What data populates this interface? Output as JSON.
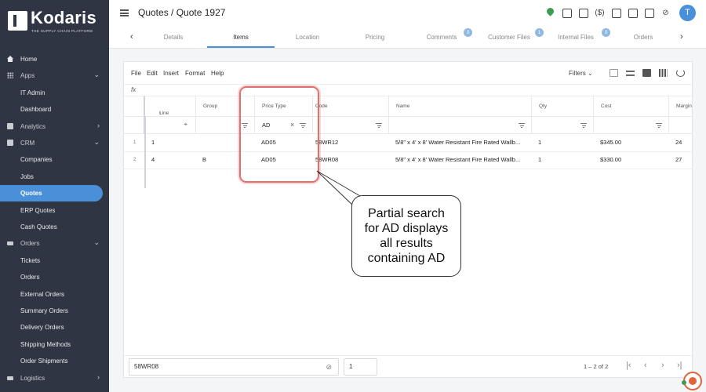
{
  "brand": {
    "name": "Kodaris",
    "tagline": "THE SUPPLY CHAIN PLATFORM"
  },
  "sidebar": {
    "items": [
      {
        "label": "Home",
        "icon": "home-icon",
        "type": "top"
      },
      {
        "label": "Apps",
        "icon": "apps-grid-icon",
        "type": "section",
        "caret": "⌄"
      },
      {
        "label": "IT Admin",
        "type": "child"
      },
      {
        "label": "Dashboard",
        "type": "child"
      },
      {
        "label": "Analytics",
        "icon": "analytics-icon",
        "type": "section",
        "caret": "›"
      },
      {
        "label": "CRM",
        "icon": "crm-icon",
        "type": "section",
        "caret": "⌄"
      },
      {
        "label": "Companies",
        "type": "child"
      },
      {
        "label": "Jobs",
        "type": "child"
      },
      {
        "label": "Quotes",
        "type": "child",
        "active": true
      },
      {
        "label": "ERP Quotes",
        "type": "child"
      },
      {
        "label": "Cash Quotes",
        "type": "child"
      },
      {
        "label": "Orders",
        "icon": "truck-icon",
        "type": "section",
        "caret": "⌄"
      },
      {
        "label": "Tickets",
        "type": "child"
      },
      {
        "label": "Orders",
        "type": "child"
      },
      {
        "label": "External Orders",
        "type": "child"
      },
      {
        "label": "Summary Orders",
        "type": "child"
      },
      {
        "label": "Delivery Orders",
        "type": "child"
      },
      {
        "label": "Shipping Methods",
        "type": "child"
      },
      {
        "label": "Order Shipments",
        "type": "child"
      },
      {
        "label": "Logistics",
        "icon": "logistics-icon",
        "type": "section",
        "caret": "›"
      }
    ]
  },
  "header": {
    "breadcrumb": "Quotes / Quote 1927",
    "avatar_initial": "T",
    "icons": [
      "location-pin-icon",
      "truck-icon",
      "calendar-icon",
      "price-icon",
      "mail-icon",
      "copy-icon",
      "document-icon",
      "attachment-icon"
    ],
    "price_icon_text": "($)"
  },
  "tabs": [
    {
      "label": "Details"
    },
    {
      "label": "Items",
      "active": true
    },
    {
      "label": "Location"
    },
    {
      "label": "Pricing"
    },
    {
      "label": "Comments",
      "badge": "0"
    },
    {
      "label": "Customer Files",
      "badge": "1"
    },
    {
      "label": "Internal Files",
      "badge": "0"
    },
    {
      "label": "Orders"
    }
  ],
  "grid": {
    "menu": [
      "File",
      "Edit",
      "Insert",
      "Format",
      "Help"
    ],
    "filters_label": "Filters",
    "fx_label": "fx",
    "columns": [
      "Line",
      "Group",
      "Price Type",
      "Code",
      "Name",
      "Qty",
      "Cost",
      "Margin"
    ],
    "sort_indicator": "↑",
    "filter_values": {
      "price_type": "AD"
    },
    "rows": [
      {
        "num": "1",
        "line": "1",
        "group": "",
        "price_type": "AD05",
        "code": "58WR12",
        "name": "5/8\" x 4' x 8' Water Resistant Fire Rated Wallb...",
        "qty": "1",
        "cost": "$345.00",
        "margin": "24"
      },
      {
        "num": "2",
        "line": "4",
        "group": "B",
        "price_type": "AD05",
        "code": "58WR08",
        "name": "5/8\" x 4' x 8' Water Resistant Fire Rated Wallb...",
        "qty": "1",
        "cost": "$330.00",
        "margin": "27"
      }
    ],
    "footer": {
      "search_value": "58WR08",
      "page_value": "1",
      "range_text": "1 – 2 of 2"
    }
  },
  "callout": {
    "lines": [
      "Partial search",
      "for AD displays",
      "all results",
      "containing AD"
    ]
  },
  "colors": {
    "sidebar": "#2f3542",
    "accent": "#4a90d9",
    "highlight": "#e07070",
    "chat": "#e0633a"
  }
}
